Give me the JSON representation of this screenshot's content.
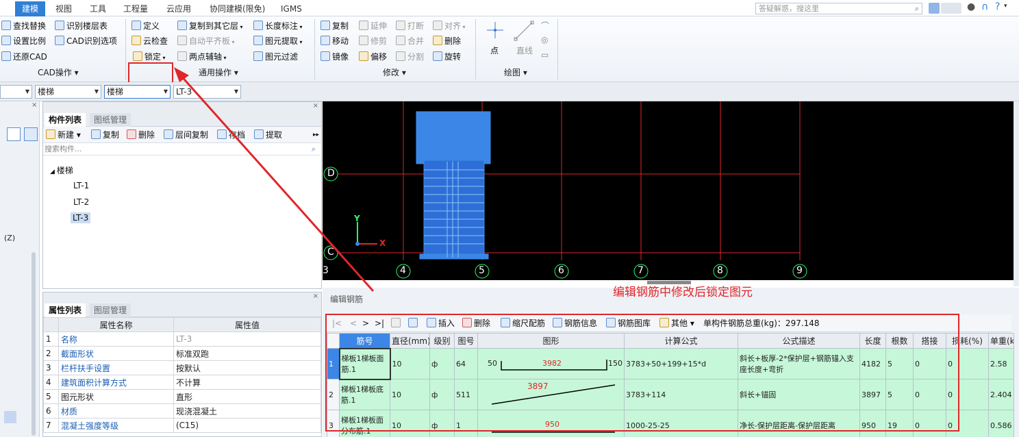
{
  "menu": {
    "tabs": [
      "建模",
      "视图",
      "工具",
      "工程量",
      "云应用",
      "协同建模(限免)",
      "IGMS"
    ],
    "help_placeholder": "答疑解惑，搜这里"
  },
  "ribbon": {
    "cad": {
      "find_replace": "查找替换",
      "set_scale": "设置比例",
      "restore_cad": "还原CAD",
      "identify_floor": "识别楼层表",
      "cad_options": "CAD识别选项",
      "group": "CAD操作 ▾"
    },
    "common": {
      "define": "定义",
      "cloud_check": "云检查",
      "lock": "锁定",
      "copy_to_floor": "复制到其它层",
      "auto_align": "自动平齐板",
      "two_point_axis": "两点辅轴",
      "length_dim": "长度标注",
      "extract_elem": "图元提取",
      "filter_elem": "图元过滤",
      "group": "通用操作 ▾"
    },
    "modify": {
      "copy": "复制",
      "extend": "延伸",
      "break": "打断",
      "align": "对齐",
      "move": "移动",
      "trim": "修剪",
      "merge": "合并",
      "delete": "删除",
      "mirror": "镜像",
      "offset": "偏移",
      "split": "分割",
      "rotate": "旋转",
      "group": "修改 ▾"
    },
    "draw": {
      "point": "点",
      "line": "直线",
      "group": "绘图 ▾"
    }
  },
  "combos": [
    "",
    "楼梯",
    "楼梯",
    "LT-3"
  ],
  "component_panel": {
    "tabs": [
      "构件列表",
      "图纸管理"
    ],
    "toolbar": [
      "新建 ▾",
      "复制",
      "删除",
      "层间复制",
      "存档",
      "提取"
    ],
    "search_placeholder": "搜索构件...",
    "root": "楼梯",
    "items": [
      "LT-1",
      "LT-2",
      "LT-3"
    ],
    "selected": "LT-3"
  },
  "left_strip": {
    "z_label": "(Z)"
  },
  "props_panel": {
    "tabs": [
      "属性列表",
      "图层管理"
    ],
    "header": [
      "",
      "属性名称",
      "属性值"
    ],
    "rows": [
      {
        "no": "1",
        "name": "名称",
        "value": "LT-3"
      },
      {
        "no": "2",
        "name": "截面形状",
        "value": "标准双跑"
      },
      {
        "no": "3",
        "name": "栏杆扶手设置",
        "value": "按默认"
      },
      {
        "no": "4",
        "name": "建筑面积计算方式",
        "value": "不计算"
      },
      {
        "no": "5",
        "name": "图元形状",
        "value": "直形"
      },
      {
        "no": "6",
        "name": "材质",
        "value": "现浇混凝土"
      },
      {
        "no": "7",
        "name": "混凝土强度等级",
        "value": "(C15)"
      }
    ]
  },
  "canvas": {
    "axis_bottom": [
      "3",
      "4",
      "5",
      "6",
      "7",
      "8",
      "9"
    ],
    "axis_left": [
      "D",
      "C"
    ],
    "y_label": "Y",
    "x_label": "X"
  },
  "rebar": {
    "title": "编辑钢筋",
    "toolbar": [
      "|<",
      "<",
      ">",
      ">|",
      "插入",
      "删除",
      "缩尺配筋",
      "钢筋信息",
      "钢筋图库",
      "其他 ▾"
    ],
    "total_weight": "单构件钢筋总重(kg)：297.148",
    "headers": [
      "",
      "筋号",
      "直径(mm)",
      "级别",
      "图号",
      "图形",
      "计算公式",
      "公式描述",
      "长度",
      "根数",
      "搭接",
      "损耗(%)",
      "单重(kg)"
    ],
    "rows": [
      {
        "idx": "1",
        "name": "梯板1梯板面筋.1",
        "dia": "10",
        "grade": "ф",
        "fig": "64",
        "shape_l": "50",
        "shape_m": "3982",
        "shape_r": "150",
        "formula": "3783+50+199+15*d",
        "desc": "斜长+板厚-2*保护层+钢筋锚入支座长度+弯折",
        "len": "4182",
        "count": "5",
        "lap": "0",
        "loss": "0",
        "unit": "2.58"
      },
      {
        "idx": "2",
        "name": "梯板1梯板底筋.1",
        "dia": "10",
        "grade": "ф",
        "fig": "511",
        "shape_l": "",
        "shape_m": "3897",
        "shape_r": "",
        "formula": "3783+114",
        "desc": "斜长+锚固",
        "len": "3897",
        "count": "5",
        "lap": "0",
        "loss": "0",
        "unit": "2.404"
      },
      {
        "idx": "3",
        "name": "梯板1梯板面分布筋.1",
        "dia": "10",
        "grade": "ф",
        "fig": "1",
        "shape_l": "",
        "shape_m": "950",
        "shape_r": "",
        "formula": "1000-25-25",
        "desc": "净长-保护层距离-保护层距离",
        "len": "950",
        "count": "19",
        "lap": "0",
        "loss": "0",
        "unit": "0.586"
      }
    ]
  },
  "annotation": "编辑钢筋中修改后锁定图元",
  "colors": {
    "accent": "#2f7fd6",
    "annot": "#e0262a",
    "row_green": "#c6f7d8",
    "canvas_bg": "#000000"
  }
}
